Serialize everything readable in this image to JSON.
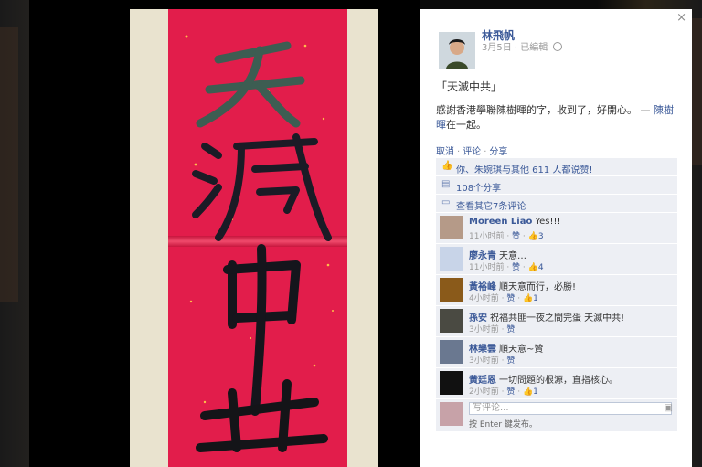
{
  "photo": {
    "calligraphy": [
      "天",
      "滅",
      "中",
      "共"
    ]
  },
  "post": {
    "close_icon": "×",
    "author": "林飛帆",
    "date": "3月5日",
    "edited": "已編輯",
    "title": "「天滅中共」",
    "body_text": "感謝香港學聯陳樹暉的字，收到了，好開心。",
    "body_dash": " — ",
    "body_link": "陳樹暉",
    "body_tail": "在一起。",
    "actions": {
      "cancel": "取消",
      "comment": "评论",
      "share": "分享",
      "sep": "·"
    }
  },
  "ufi": {
    "likes": "你、朱婉琪与其他 611 人都说赞!",
    "shares": "108个分享",
    "view_more": "查看其它7条评论"
  },
  "comments": [
    {
      "name": "Moreen Liao",
      "text": "Yes!!!",
      "time": "11小时前",
      "like": "赞",
      "count": "3",
      "avatar": "#b59a88"
    },
    {
      "name": "廖永青",
      "text": "天意…",
      "time": "11小时前",
      "like": "赞",
      "count": "4",
      "avatar": "#c8d4e8"
    },
    {
      "name": "黃裕峰",
      "text": "順天意而行，必勝!",
      "time": "4小时前",
      "like": "赞",
      "count": "1",
      "avatar": "#8a5a1a"
    },
    {
      "name": "孫安",
      "text": "祝福共匪一夜之間完蛋 天滅中共!",
      "time": "3小时前",
      "like": "赞",
      "count": "",
      "avatar": "#4a4a42"
    },
    {
      "name": "林樂雲",
      "text": "順天意~贊",
      "time": "3小时前",
      "like": "赞",
      "count": "",
      "avatar": "#6a7890"
    },
    {
      "name": "黃廷恩",
      "text": "一切問題的根源，直指核心。",
      "time": "2小时前",
      "like": "赞",
      "count": "1",
      "avatar": "#111111"
    }
  ],
  "reply": {
    "placeholder": "写评论...",
    "hint": "按 Enter 鍵发布。",
    "camera_icon": "camera-icon"
  },
  "colors": {
    "link": "#3b5998",
    "ufi_bg": "#edeff4",
    "paper": "#e21d4b"
  }
}
